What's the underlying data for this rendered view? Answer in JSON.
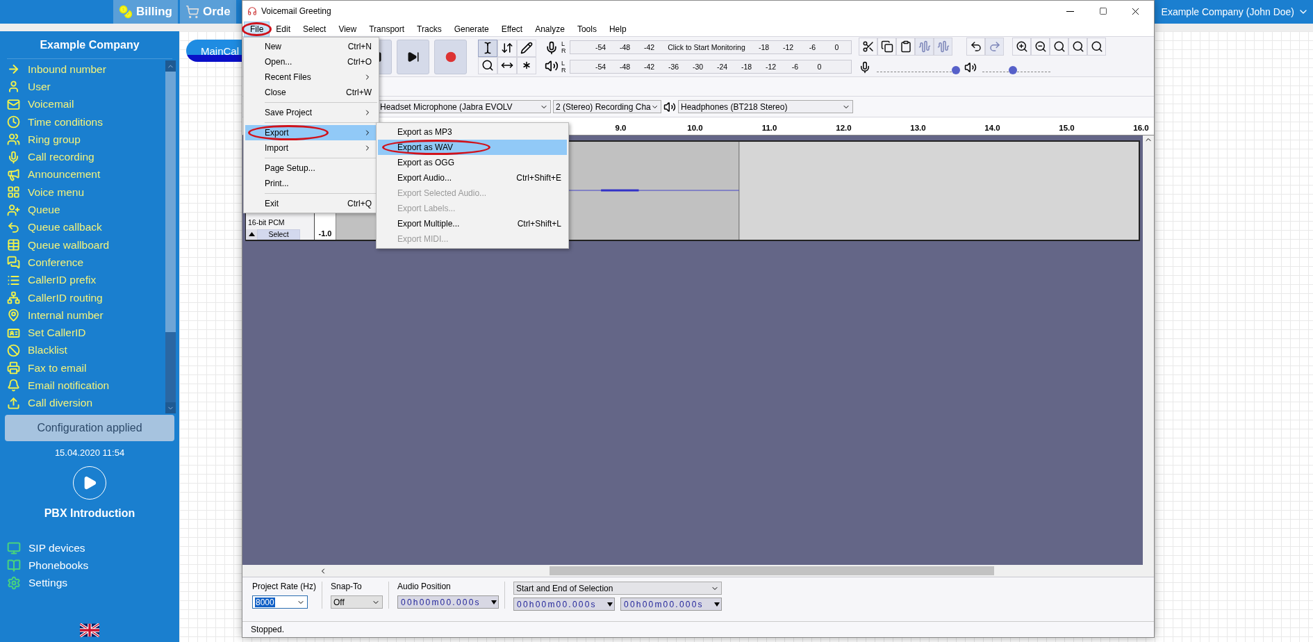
{
  "top_nav": {
    "tabs": [
      {
        "label": "Billing"
      },
      {
        "label": "Orde"
      }
    ],
    "account": "Example Company (John Doe)"
  },
  "sidebar": {
    "title": "Example Company",
    "items": [
      "Inbound number",
      "User",
      "Voicemail",
      "Time conditions",
      "Ring group",
      "Call recording",
      "Announcement",
      "Voice menu",
      "Queue",
      "Queue callback",
      "Queue wallboard",
      "Conference",
      "CallerID prefix",
      "CallerID routing",
      "Internal number",
      "Set CallerID",
      "Blacklist",
      "Fax to email",
      "Email notification",
      "Call diversion"
    ],
    "status_button": "Configuration applied",
    "timestamp": "15.04.2020 11:54",
    "intro_label": "PBX Introduction",
    "bottom_items": [
      "SIP devices",
      "Phonebooks",
      "Settings"
    ]
  },
  "canvas": {
    "node_button": "MainCal"
  },
  "window": {
    "title": "Voicemail Greeting",
    "menu_bar": [
      {
        "label": "File",
        "selected": true,
        "circled": true
      },
      {
        "label": "Edit",
        "selected": false,
        "circled": false
      },
      {
        "label": "Select",
        "selected": false,
        "circled": false
      },
      {
        "label": "View",
        "selected": false,
        "circled": false
      },
      {
        "label": "Transport",
        "selected": false,
        "circled": false
      },
      {
        "label": "Tracks",
        "selected": false,
        "circled": false
      },
      {
        "label": "Generate",
        "selected": false,
        "circled": false
      },
      {
        "label": "Effect",
        "selected": false,
        "circled": false
      },
      {
        "label": "Analyze",
        "selected": false,
        "circled": false
      },
      {
        "label": "Tools",
        "selected": false,
        "circled": false
      },
      {
        "label": "Help",
        "selected": false,
        "circled": false
      }
    ],
    "file_menu": [
      {
        "kind": "item",
        "label": "New",
        "shortcut": "Ctrl+N",
        "selected": false,
        "circled": false
      },
      {
        "kind": "item",
        "label": "Open...",
        "shortcut": "Ctrl+O",
        "selected": false,
        "circled": false
      },
      {
        "kind": "submenu",
        "label": "Recent Files",
        "selected": false,
        "circled": false
      },
      {
        "kind": "item",
        "label": "Close",
        "shortcut": "Ctrl+W",
        "selected": false,
        "circled": false
      },
      {
        "kind": "separator"
      },
      {
        "kind": "submenu",
        "label": "Save Project",
        "selected": false,
        "circled": false
      },
      {
        "kind": "separator"
      },
      {
        "kind": "submenu",
        "label": "Export",
        "selected": true,
        "circled": true
      },
      {
        "kind": "submenu",
        "label": "Import",
        "selected": false,
        "circled": false
      },
      {
        "kind": "separator"
      },
      {
        "kind": "item",
        "label": "Page Setup...",
        "selected": false,
        "circled": false
      },
      {
        "kind": "item",
        "label": "Print...",
        "selected": false,
        "circled": false
      },
      {
        "kind": "separator"
      },
      {
        "kind": "item",
        "label": "Exit",
        "shortcut": "Ctrl+Q",
        "selected": false,
        "circled": false
      }
    ],
    "export_submenu": [
      {
        "label": "Export as MP3",
        "disabled": false,
        "selected": false,
        "circled": false
      },
      {
        "label": "Export as WAV",
        "disabled": false,
        "selected": true,
        "circled": true
      },
      {
        "label": "Export as OGG",
        "disabled": false,
        "selected": false,
        "circled": false
      },
      {
        "label": "Export Audio...",
        "shortcut": "Ctrl+Shift+E",
        "disabled": false,
        "selected": false,
        "circled": false
      },
      {
        "label": "Export Selected Audio...",
        "disabled": true,
        "selected": false,
        "circled": false
      },
      {
        "label": "Export Labels...",
        "disabled": true,
        "selected": false,
        "circled": false
      },
      {
        "label": "Export Multiple...",
        "shortcut": "Ctrl+Shift+L",
        "disabled": false,
        "selected": false,
        "circled": false
      },
      {
        "label": "Export MIDI...",
        "disabled": true,
        "selected": false,
        "circled": false
      }
    ],
    "meters": [
      {
        "kind": "record",
        "channels": [
          "L",
          "R"
        ],
        "ticks": [
          "-54",
          "-48",
          "-42"
        ],
        "prompt": "Click to Start Monitoring",
        "ticks_after": [
          "-18",
          "-12",
          "-6",
          "0"
        ]
      },
      {
        "kind": "playback",
        "channels": [
          "L",
          "R"
        ],
        "ticks": [
          "-54",
          "-48",
          "-42",
          "-36",
          "-30",
          "-24",
          "-18",
          "-12",
          "-6",
          "0"
        ]
      }
    ],
    "sliders": [
      {
        "kind": "record",
        "level": 0.97
      },
      {
        "kind": "playback",
        "level": 0.45
      }
    ],
    "devices": {
      "recording_device": "Headset Microphone (Jabra EVOLV",
      "channels": "2 (Stereo) Recording Cha",
      "playback_device": "Headphones (BT218 Stereo)"
    },
    "ruler": [
      "9.0",
      "10.0",
      "11.0",
      "12.0",
      "13.0",
      "14.0",
      "15.0",
      "16.0"
    ],
    "track": {
      "info": "16-bit PCM",
      "select_button": "Select",
      "scale_label": "-1.0"
    },
    "selection_toolbar": {
      "project_rate_label": "Project Rate (Hz)",
      "project_rate": "8000",
      "snap_to_label": "Snap-To",
      "snap_to": "Off",
      "audio_position_label": "Audio Position",
      "audio_position": "00h00m00.000s",
      "selection_format": "Start and End of Selection",
      "selection_start": "00h00m00.000s",
      "selection_end": "00h00m00.000s"
    },
    "status": "Stopped."
  }
}
